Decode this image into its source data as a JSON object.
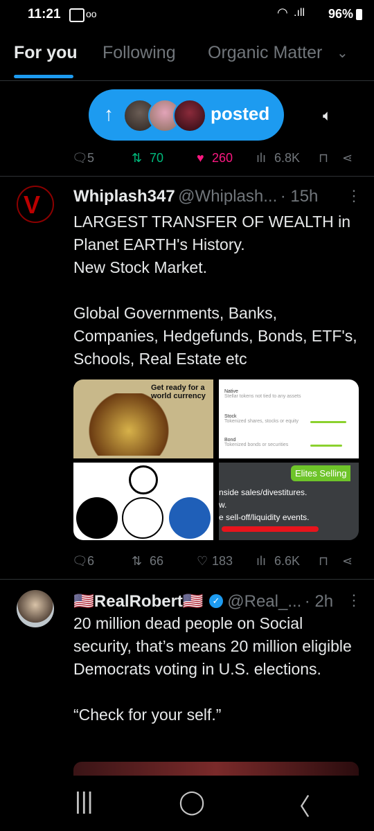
{
  "status_bar": {
    "time": "11:21",
    "battery": "96%"
  },
  "tabs": [
    {
      "label": "For you"
    },
    {
      "label": "Following"
    },
    {
      "label": "Organic Matter"
    }
  ],
  "pill": {
    "label": "posted"
  },
  "top_actions": {
    "replies": "5",
    "reposts": "70",
    "likes": "260",
    "views": "6.8K"
  },
  "tweet1": {
    "name": "Whiplash347",
    "handle": "@Whiplash...",
    "time": "· 15h",
    "text": "LARGEST TRANSFER OF WEALTH in Planet EARTH's History.\nNew Stock Market.\n\nGlobal Governments, Banks, Companies, Hedgefunds, Bonds, ETF's, Schools, Real Estate etc",
    "media": {
      "img1_caption": "Get ready for a world currency",
      "img2_rows": [
        {
          "title": "Native",
          "sub": "Stellar tokens not tied to any assets"
        },
        {
          "title": "Stock",
          "sub": "Tokenized shares, stocks or equity"
        },
        {
          "title": "Bond",
          "sub": "Tokenized bonds or securities"
        }
      ],
      "img4_badge": "Elites Selling",
      "img4_lines": [
        "nside sales/divestitures.",
        "w.",
        "e sell-off/liquidity events."
      ]
    },
    "actions": {
      "replies": "6",
      "reposts": "66",
      "likes": "183",
      "views": "6.6K"
    }
  },
  "tweet2": {
    "name": "🇺🇸RealRobert🇺🇸",
    "handle": "@Real_...",
    "time": "· 2h",
    "text": "20 million dead people on Social security, that’s means 20 million eligible Democrats voting in U.S. elections.\n\n“Check for your self.”"
  },
  "colors": {
    "accent": "#1d9bf0",
    "like": "#f91880",
    "repost": "#00ba7c",
    "verified": "#1d9bf0"
  }
}
